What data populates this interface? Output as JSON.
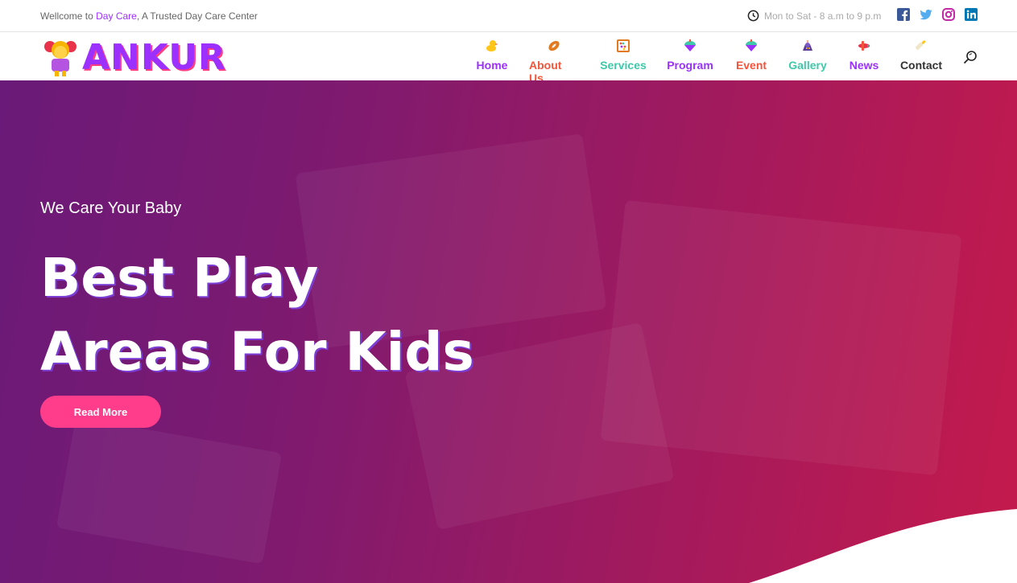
{
  "topbar": {
    "welcome_prefix": "Wellcome to ",
    "welcome_highlight": "Day Care",
    "welcome_suffix": ", A Trusted Day Care Center",
    "hours": "Mon to Sat - 8 a.m to 9 p.m",
    "social": [
      "facebook-icon",
      "twitter-icon",
      "instagram-icon",
      "linkedin-icon"
    ]
  },
  "brand": {
    "name": "ANKUR"
  },
  "nav": [
    {
      "label": "Home",
      "color": "#9b30ff"
    },
    {
      "label": "About Us",
      "color": "#f2553b"
    },
    {
      "label": "Services",
      "color": "#3fc9a8"
    },
    {
      "label": "Program",
      "color": "#9b30ff"
    },
    {
      "label": "Event",
      "color": "#f2553b"
    },
    {
      "label": "Gallery",
      "color": "#3fc9a8"
    },
    {
      "label": "News",
      "color": "#9b30ff"
    },
    {
      "label": "Contact",
      "color": "#333333"
    }
  ],
  "hero": {
    "tagline": "We Care Your Baby",
    "headline_line1": "Best Play",
    "headline_line2": "Areas For Kids",
    "button": "Read More"
  },
  "colors": {
    "accent": "#9b30ff",
    "button": "#ff3d8a",
    "hero_start": "#6a1a78",
    "hero_end": "#c41a4c"
  }
}
